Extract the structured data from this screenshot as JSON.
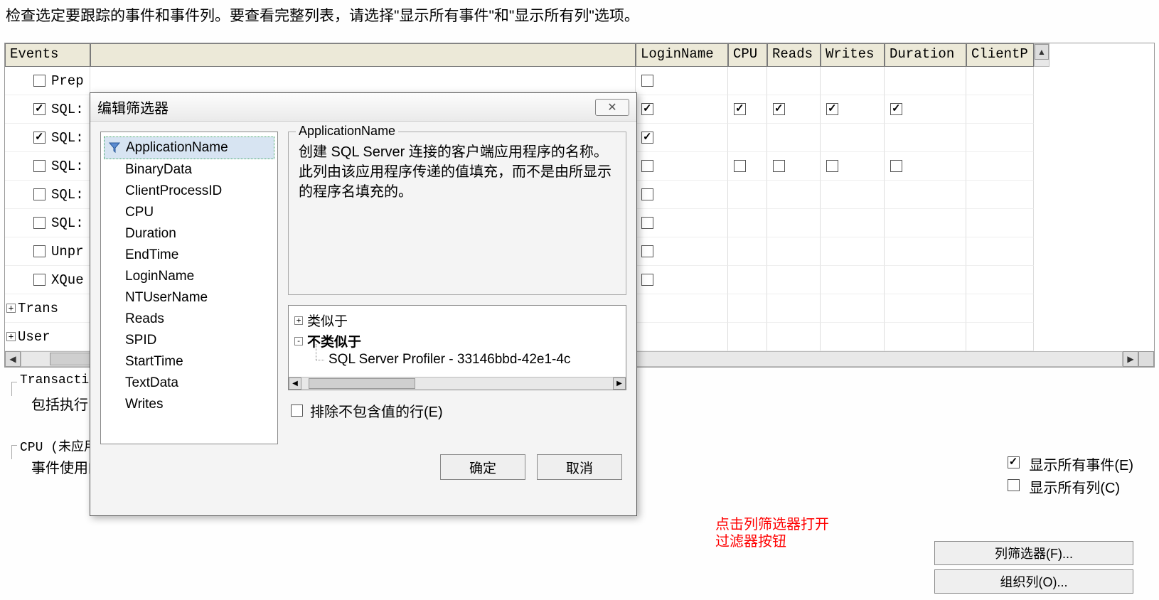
{
  "instruction": "检查选定要跟踪的事件和事件列。要查看完整列表，请选择\"显示所有事件\"和\"显示所有列\"选项。",
  "grid": {
    "headers": {
      "events": "Events",
      "loginname": "LoginName",
      "cpu": "CPU",
      "reads": "Reads",
      "writes": "Writes",
      "duration": "Duration",
      "clientp": "ClientP"
    },
    "rows": [
      {
        "label": "Prep",
        "checked": false,
        "login": false,
        "cpu": null,
        "reads": null,
        "writes": null,
        "dur": null
      },
      {
        "label": "SQL:",
        "checked": true,
        "login": true,
        "cpu": true,
        "reads": true,
        "writes": true,
        "dur": true
      },
      {
        "label": "SQL:",
        "checked": true,
        "login": true,
        "cpu": null,
        "reads": null,
        "writes": null,
        "dur": null
      },
      {
        "label": "SQL:",
        "checked": false,
        "login": false,
        "cpu": false,
        "reads": false,
        "writes": false,
        "dur": false
      },
      {
        "label": "SQL:",
        "checked": false,
        "login": false,
        "cpu": null,
        "reads": null,
        "writes": null,
        "dur": null
      },
      {
        "label": "SQL:",
        "checked": false,
        "login": false,
        "cpu": null,
        "reads": null,
        "writes": null,
        "dur": null
      },
      {
        "label": "Unpr",
        "checked": false,
        "login": false,
        "cpu": null,
        "reads": null,
        "writes": null,
        "dur": null
      },
      {
        "label": "XQue",
        "checked": false,
        "login": false,
        "cpu": null,
        "reads": null,
        "writes": null,
        "dur": null
      },
      {
        "label": "Trans",
        "group": true
      },
      {
        "label": "User",
        "group": true
      }
    ]
  },
  "dialog": {
    "title": "编辑筛选器",
    "close": "✕",
    "listItems": [
      "ApplicationName",
      "BinaryData",
      "ClientProcessID",
      "CPU",
      "Duration",
      "EndTime",
      "LoginName",
      "NTUserName",
      "Reads",
      "SPID",
      "StartTime",
      "TextData",
      "Writes"
    ],
    "selected": "ApplicationName",
    "descLegend": "ApplicationName",
    "descText": "创建 SQL Server 连接的客户端应用程序的名称。此列由该应用程序传递的值填充，而不是由所显示的程序名填充的。",
    "tree": {
      "like": "类似于",
      "notlike": "不类似于",
      "child": "SQL Server Profiler - 33146bbd-42e1-4c"
    },
    "excludeLabel": "排除不包含值的行(E)",
    "ok": "确定",
    "cancel": "取消"
  },
  "transBox": {
    "title": "Transaction",
    "desc": "包括执行"
  },
  "cpuBox": {
    "title": "CPU (未应用筛选器)",
    "desc": "事件使用的 CPU 时间(毫秒)。"
  },
  "rightOptions": {
    "showAllEvents": "显示所有事件(E)",
    "showAllCols": "显示所有列(C)"
  },
  "redAnnot": {
    "line1": "点击列筛选器打开",
    "line2": "过滤器按钮"
  },
  "buttons": {
    "colFilter": "列筛选器(F)...",
    "organize": "组织列(O)..."
  }
}
